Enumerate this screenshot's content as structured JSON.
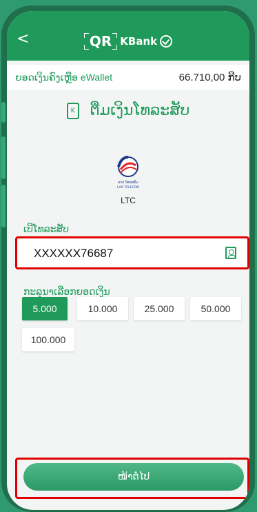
{
  "header": {
    "back_symbol": "<",
    "brand_qr": "QR",
    "brand_bank": "KBank"
  },
  "balance": {
    "label": "ຍອດເງິນຄົງເຫຼືອ eWallet",
    "value": "66.710,00 ກີບ"
  },
  "page": {
    "title": "ຕື່ມເງິນໂທລະສັບ",
    "topup_icon_glyph": "K"
  },
  "operator": {
    "logo_name": "ລາວ ໂທລະຄົມ",
    "logo_sub": "LAO TELECOM",
    "name": "LTC"
  },
  "phone": {
    "label": "ເບີໂທລະສັບ",
    "value": "XXXXXX76687"
  },
  "amount": {
    "label": "ກະລຸນາເລືອກຍອດເງິນ",
    "options": [
      "5.000",
      "10.000",
      "25.000",
      "50.000",
      "100.000"
    ],
    "selected": "5.000"
  },
  "footer": {
    "next_label": "ໜ້າຕໍ່ໄປ"
  },
  "colors": {
    "accent": "#1f9a5a",
    "highlight": "#e00000",
    "background": "#2f9a6f"
  }
}
